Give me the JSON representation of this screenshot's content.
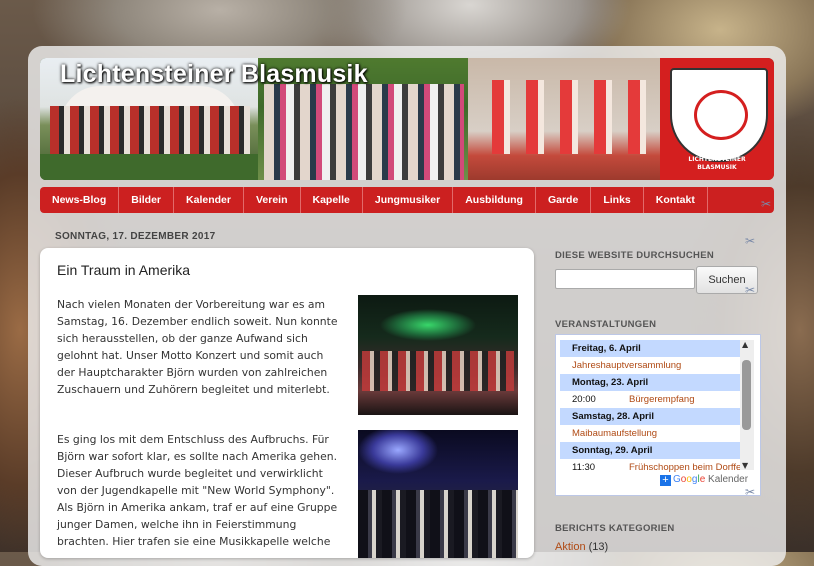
{
  "site": {
    "title": "Lichtensteiner Blasmusik",
    "crest_text": "LICHTENSTEINER BLASMUSIK",
    "accent": "#cc2020"
  },
  "nav": {
    "items": [
      "News-Blog",
      "Bilder",
      "Kalender",
      "Verein",
      "Kapelle",
      "Jungmusiker",
      "Ausbildung",
      "Garde",
      "Links",
      "Kontakt"
    ]
  },
  "post": {
    "date_header": "SONNTAG, 17. DEZEMBER 2017",
    "title": "Ein Traum in Amerika",
    "p1": "Nach vielen Monaten der Vorbereitung war es am Samstag, 16. Dezember endlich soweit. Nun konnte sich herausstellen, ob der ganze Aufwand sich gelohnt hat. Unser Motto Konzert und somit auch der Hauptcharakter Björn wurden von zahlreichen Zuschauern und Zuhörern begleitet und miterlebt.",
    "p2": "Es ging los mit dem Entschluss des Aufbruchs. Für Björn war sofort klar, es sollte nach Amerika gehen. Dieser Aufbruch wurde begleitet und verwirklicht von der Jugendkapelle mit \"New World Symphony\". Als Björn in Amerika ankam, traf er auf eine Gruppe junger Damen, welche ihn in Feierstimmung brachten. Hier trafen sie eine Musikkapelle welche"
  },
  "sidebar": {
    "search_heading": "DIESE WEBSITE DURCHSUCHEN",
    "search_button": "Suchen",
    "search_value": "",
    "events_heading": "VERANSTALTUNGEN",
    "events": [
      {
        "day": "Freitag, 6. April",
        "items": [
          {
            "time": "",
            "title": "Jahreshauptversammlung"
          }
        ]
      },
      {
        "day": "Montag, 23. April",
        "items": [
          {
            "time": "20:00",
            "title": "Bürgerempfang"
          }
        ]
      },
      {
        "day": "Samstag, 28. April",
        "items": [
          {
            "time": "",
            "title": "Maibaumaufstellung"
          }
        ]
      },
      {
        "day": "Sonntag, 29. April",
        "items": [
          {
            "time": "11:30",
            "title": "Frühschoppen beim Dorffest"
          }
        ]
      }
    ],
    "calendar_footer": {
      "brand": "Google",
      "label": "Kalender"
    },
    "categories_heading": "BERICHTS KATEGORIEN",
    "categories": [
      {
        "name": "Aktion",
        "count": "(13)"
      }
    ]
  }
}
